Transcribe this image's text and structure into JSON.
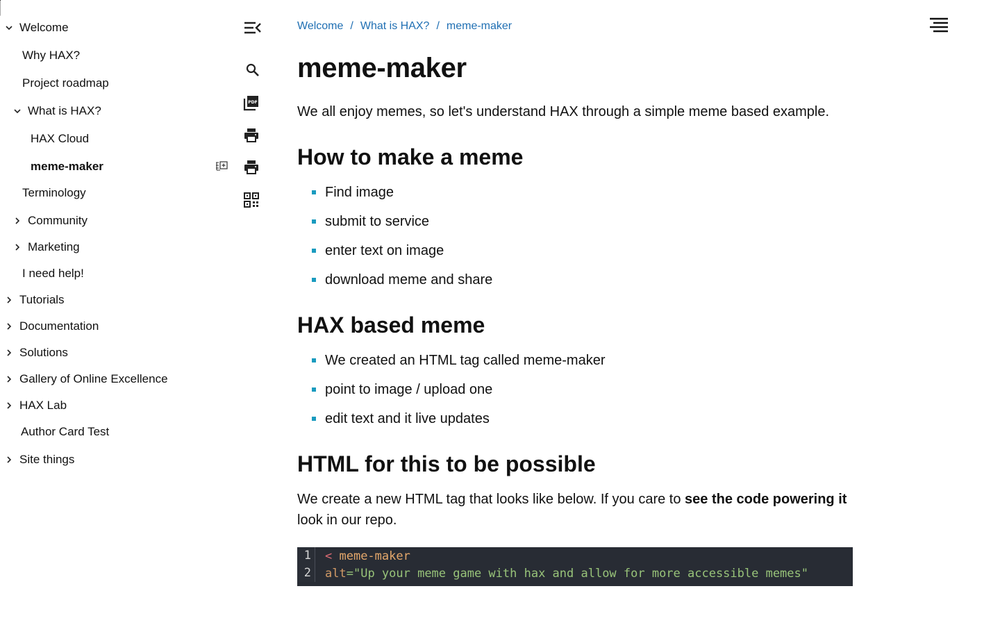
{
  "sidebar": {
    "items": [
      {
        "label": "Welcome",
        "chevron": "down"
      },
      {
        "label": "Why HAX?",
        "chevron": "none"
      },
      {
        "label": "Project roadmap",
        "chevron": "none"
      },
      {
        "label": "What is HAX?",
        "chevron": "down"
      },
      {
        "label": "HAX Cloud",
        "chevron": "none"
      },
      {
        "label": "meme-maker",
        "chevron": "none",
        "active": true
      },
      {
        "label": "Terminology",
        "chevron": "none"
      },
      {
        "label": "Community",
        "chevron": "right"
      },
      {
        "label": "Marketing",
        "chevron": "right"
      },
      {
        "label": "I need help!",
        "chevron": "none"
      },
      {
        "label": "Tutorials",
        "chevron": "right"
      },
      {
        "label": "Documentation",
        "chevron": "right"
      },
      {
        "label": "Solutions",
        "chevron": "right"
      },
      {
        "label": "Gallery of Online Excellence",
        "chevron": "right"
      },
      {
        "label": "HAX Lab",
        "chevron": "right"
      },
      {
        "label": "Author Card Test",
        "chevron": "none"
      },
      {
        "label": "Site things",
        "chevron": "right"
      }
    ],
    "active_item_action_icon": "add-child-page-icon"
  },
  "toolbar": {
    "icons": [
      "collapse-menu-icon",
      "search-icon",
      "pdf-icon",
      "print-icon",
      "print-icon",
      "qr-code-icon"
    ]
  },
  "top_menu_icon": "menu-lines-icon",
  "breadcrumb": {
    "items": [
      "Welcome",
      "What is HAX?",
      "meme-maker"
    ],
    "separator": "/"
  },
  "content": {
    "title": "meme-maker",
    "intro": "We all enjoy memes, so let's understand HAX through a simple meme based example.",
    "section1": {
      "heading": "How to make a meme",
      "bullets": [
        "Find image",
        "submit to service",
        "enter text on image",
        "download meme and share"
      ]
    },
    "section2": {
      "heading": "HAX based meme",
      "bullets": [
        "We created an HTML tag called meme-maker",
        "point to image / upload one",
        "edit text and it live updates"
      ]
    },
    "section3": {
      "heading": "HTML for this to be possible",
      "para_before": "We create a new HTML tag that looks like below. If you care to ",
      "para_bold": "see the code powering it",
      "para_after": "look in our repo."
    },
    "code": {
      "lines": [
        {
          "num": "1",
          "tag": "< ",
          "name": "meme-maker"
        },
        {
          "num": "2",
          "attr": "alt",
          "eq": "=",
          "value": "\"Up your meme game with hax and allow for more accessible memes\""
        }
      ]
    }
  },
  "colors": {
    "link": "#1f6fb3",
    "bullet": "#1a9bbf",
    "code_bg": "#282c34",
    "code_string": "#98c379",
    "code_tag": "#e06c75"
  }
}
